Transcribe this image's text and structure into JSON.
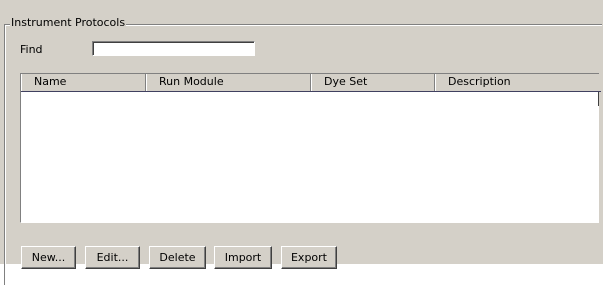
{
  "group": {
    "title": "Instrument Protocols"
  },
  "find": {
    "label": "Find",
    "value": "",
    "placeholder": ""
  },
  "table": {
    "columns": [
      "Name",
      "Run Module",
      "Dye Set",
      "Description"
    ],
    "rows": []
  },
  "buttons": {
    "new_label": "New...",
    "edit_label": "Edit...",
    "delete_label": "Delete",
    "import_label": "Import",
    "export_label": "Export"
  }
}
